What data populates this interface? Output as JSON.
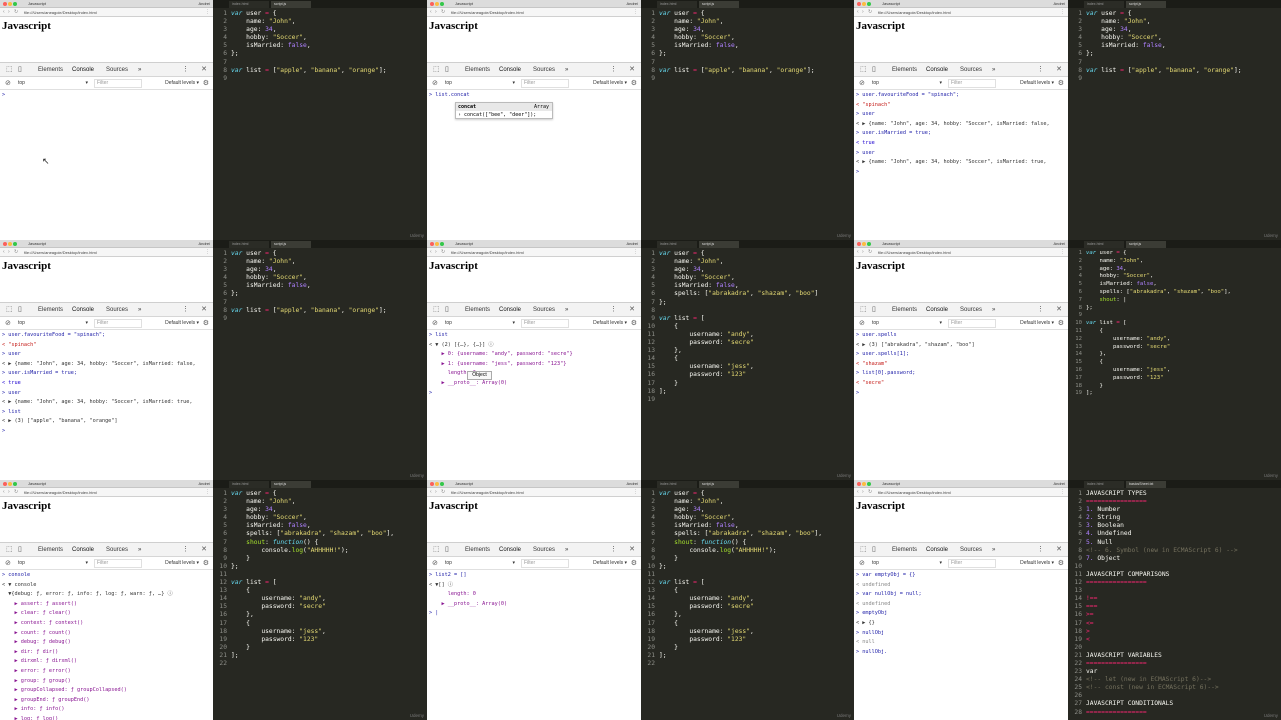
{
  "browser": {
    "tab_title": "Javascript",
    "url": "file:///Users/aneagoie/Desktop/index.html",
    "profile": "Andrei",
    "page_heading": "Javascript",
    "devtools_tabs": [
      "Elements",
      "Console",
      "Sources"
    ],
    "more_tabs": "»",
    "context": "top",
    "filter_placeholder": "Filter",
    "levels": "Default levels",
    "watermark": "Udemy"
  },
  "editor": {
    "tab_active": "script.js",
    "tab_other": "index.html",
    "tab_other2": "basicsSheet.txt"
  },
  "panels": {
    "b1": {
      "lines": [
        ">"
      ]
    },
    "b2": {
      "lines": [
        "> list.concat"
      ],
      "autocomplete": {
        "label": "concat",
        "type": "Array",
        "detail": "› concat([\"bee\", \"deer\"]);"
      }
    },
    "b3": {
      "lines": [
        "> user.favouriteFood = \"spinach\";",
        "< \"spinach\"",
        "> user",
        "< ▶ {name: \"John\", age: 34, hobby: \"Soccer\", isMarried: false,",
        "> user.isMarried = true;",
        "< true",
        "> user",
        "< ▶ {name: \"John\", age: 34, hobby: \"Soccer\", isMarried: true,",
        ">"
      ]
    },
    "b4": {
      "lines": [
        "> user.favouriteFood = \"spinach\";",
        "< \"spinach\"",
        "> user",
        "< ▶ {name: \"John\", age: 34, hobby: \"Soccer\", isMarried: false,",
        "> user.isMarried = true;",
        "< true",
        "> user",
        "< ▶ {name: \"John\", age: 34, hobby: \"Soccer\", isMarried: true,",
        "> list",
        "< ▶ (3) [\"apple\", \"banana\", \"orange\"]",
        ">"
      ]
    },
    "b5": {
      "lines": [
        "> list",
        "< ▼ (2) [{…}, {…}] ⓘ",
        "    ▶ 0: {username: \"andy\", password: \"secre\"}",
        "    ▶ 1: {username: \"jess\", password: \"123\"}",
        "      length: 2",
        "    ▶ __proto__: Array(0)",
        ">"
      ],
      "tooltip": "Object"
    },
    "b6": {
      "lines": [
        "> user.spells",
        "< ▶ (3) [\"abrakadra\", \"shazam\", \"boo\"]",
        "> user.spells[1];",
        "< \"shazam\"",
        "> list[0].password;",
        "< \"secre\"",
        ">"
      ]
    },
    "b7": {
      "lines": [
        "> console",
        "< ▼ console",
        "  ▼{debug: ƒ, error: ƒ, info: ƒ, log: ƒ, warn: ƒ, …} ⓘ",
        "    ▶ assert: ƒ assert()",
        "    ▶ clear: ƒ clear()",
        "    ▶ context: ƒ context()",
        "    ▶ count: ƒ count()",
        "    ▶ debug: ƒ debug()",
        "    ▶ dir: ƒ dir()",
        "    ▶ dirxml: ƒ dirxml()",
        "    ▶ error: ƒ error()",
        "    ▶ group: ƒ group()",
        "    ▶ groupCollapsed: ƒ groupCollapsed()",
        "    ▶ groupEnd: ƒ groupEnd()",
        "    ▶ info: ƒ info()",
        "    ▶ log: ƒ log()",
        "    ▶ markTimeline: ƒ markTimeline()",
        "      memory: (...)"
      ]
    },
    "b8": {
      "lines": [
        "> list2 = []",
        "< ▼[] ⓘ",
        "      length: 0",
        "    ▶ __proto__: Array(0)",
        "> |"
      ]
    },
    "b9": {
      "lines": [
        "> var emptyObj = {}",
        "< undefined",
        "> var nullObj = null;",
        "< undefined",
        "> emptyObj",
        "< ▶ {}",
        "> nullObj",
        "< null",
        "> nullObj."
      ]
    }
  },
  "code": {
    "e1": [
      "var user = {",
      "    name: \"John\",",
      "    age: 34,",
      "    hobby: \"Soccer\",",
      "    isMarried: false,",
      "};",
      "",
      "var list = [\"apple\", \"banana\", \"orange\"];",
      ""
    ],
    "e5": [
      "var user = {",
      "    name: \"John\",",
      "    age: 34,",
      "    hobby: \"Soccer\",",
      "    isMarried: false,",
      "    spells: [\"abrakadra\", \"shazam\", \"boo\"]",
      "};",
      "",
      "var list = [",
      "    {",
      "        username: \"andy\",",
      "        password: \"secre\"",
      "    },",
      "    {",
      "        username: \"jess\",",
      "        password: \"123\"",
      "    }",
      "];",
      ""
    ],
    "e6": [
      "var user = {",
      "    name: \"John\",",
      "    age: 34,",
      "    hobby: \"Soccer\",",
      "    isMarried: false,",
      "    spells: [\"abrakadra\", \"shazam\", \"boo\"],",
      "    shout: |",
      "};",
      "",
      "var list = [",
      "    {",
      "        username: \"andy\",",
      "        password: \"secre\"",
      "    },",
      "    {",
      "        username: \"jess\",",
      "        password: \"123\"",
      "    }",
      "];"
    ],
    "e7": [
      "var user = {",
      "    name: \"John\",",
      "    age: 34,",
      "    hobby: \"Soccer\",",
      "    isMarried: false,",
      "    spells: [\"abrakadra\", \"shazam\", \"boo\"],",
      "    shout: function() {",
      "        console.log(\"AHHHHH!\");",
      "    }",
      "};",
      "",
      "var list = [",
      "    {",
      "        username: \"andy\",",
      "        password: \"secre\"",
      "    },",
      "    {",
      "        username: \"jess\",",
      "        password: \"123\"",
      "    }",
      "];",
      ""
    ],
    "e9": [
      "JAVASCRIPT TYPES",
      "================",
      "1. Number",
      "2. String",
      "3. Boolean",
      "4. Undefined",
      "5. Null",
      "<!-- 6. Symbol (new in ECMAScript 6) -->",
      "7. Object",
      "",
      "JAVASCRIPT COMPARISONS",
      "================",
      "",
      "!==",
      "===",
      ">=",
      "<=",
      ">",
      "<",
      "",
      "JAVASCRIPT VARIABLES",
      "================",
      "var",
      "<!-- let (new in ECMAScript 6)-->",
      "<!-- const (new in ECMAScript 6)-->",
      "",
      "JAVASCRIPT CONDITIONALS",
      "================"
    ]
  }
}
